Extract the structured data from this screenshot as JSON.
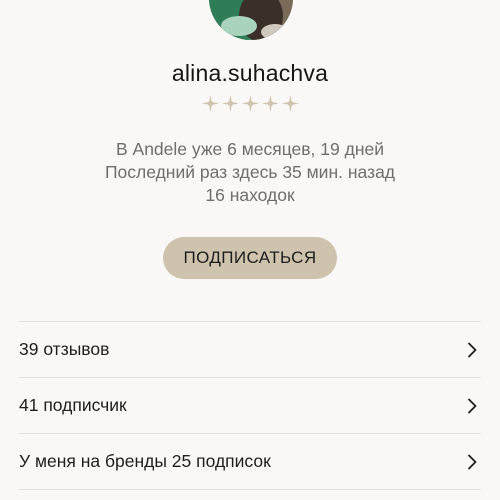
{
  "profile": {
    "username": "alina.suhachva",
    "rating_stars": 5,
    "rating_filled": 0,
    "info_lines": [
      "В Andele уже 6 месяцев, 19 дней",
      "Последний раз здесь 35 мин. назад",
      "16 находок"
    ]
  },
  "actions": {
    "follow_label": "ПОДПИСАТЬСЯ"
  },
  "menu": [
    {
      "label": "39 отзывов",
      "icon": "chevron-right-icon"
    },
    {
      "label": "41 подписчик",
      "icon": "chevron-right-icon"
    },
    {
      "label": "У меня на бренды 25 подписок",
      "icon": "chevron-right-icon"
    }
  ],
  "colors": {
    "background": "#f9f8f6",
    "accent": "#cfc3ae",
    "star": "#cfc3ae",
    "secondary_text": "#6e6e6e"
  }
}
